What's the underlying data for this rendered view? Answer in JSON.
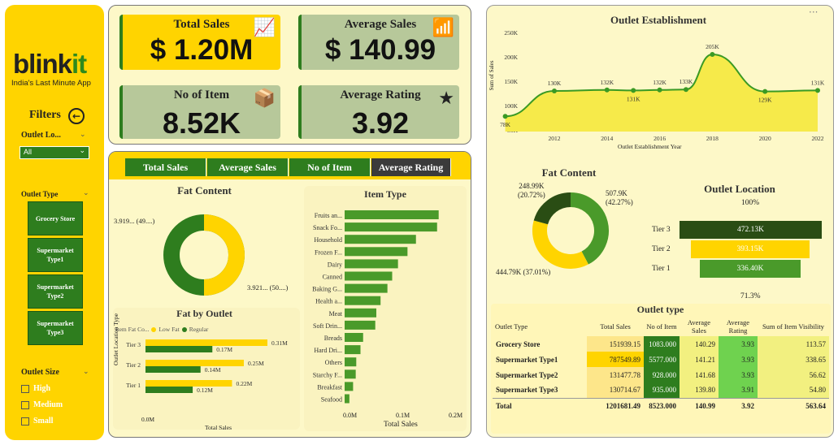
{
  "sidebar": {
    "logo_main": "blink",
    "logo_accent": "it",
    "tagline": "India's Last Minute App",
    "filters_label": "Filters",
    "outlet_location_label": "Outlet Lo...",
    "outlet_location_value": "All",
    "outlet_type_label": "Outlet Type",
    "outlet_types": [
      "Grocery Store",
      "Supermarket Type1",
      "Supermarket Type2",
      "Supermarket Type3"
    ],
    "outlet_size_label": "Outlet Size",
    "outlet_sizes": [
      "High",
      "Medium",
      "Small"
    ]
  },
  "kpis": {
    "total_sales": {
      "title": "Total Sales",
      "value": "$ 1.20M"
    },
    "average_sales": {
      "title": "Average Sales",
      "value": "$ 140.99"
    },
    "no_of_item": {
      "title": "No of Item",
      "value": "8.52K"
    },
    "average_rating": {
      "title": "Average Rating",
      "value": "3.92"
    }
  },
  "tabs": [
    "Total Sales",
    "Average Sales",
    "No of Item",
    "Average Rating"
  ],
  "active_tab": "Average Rating",
  "colors": {
    "yellow": "#ffd400",
    "green": "#2e7d1e",
    "dark_green": "#2a4d14",
    "light_green": "#4a9a2a",
    "kpi_green": "#b7c89a",
    "panel_bg": "#fdf8c8"
  },
  "fat_content_left": {
    "title": "Fat Content",
    "label_left": "3.919... (49....)",
    "label_right": "3.921... (50....)"
  },
  "fat_by_outlet": {
    "title": "Fat by Outlet",
    "legend_title": "Item Fat Co...",
    "legend": [
      "Low Fat",
      "Regular"
    ],
    "ylabel": "Outlet Location Type",
    "xlabel": "Total Sales",
    "x_tick": "0.0M",
    "tiers": [
      "Tier 3",
      "Tier 2",
      "Tier 1"
    ],
    "labels_low": [
      "0.31M",
      "0.25M",
      "0.22M"
    ],
    "labels_reg": [
      "0.17M",
      "0.14M",
      "0.12M"
    ]
  },
  "item_type": {
    "title": "Item Type",
    "xlabel": "Total Sales",
    "x_ticks": [
      "0.0M",
      "0.1M",
      "0.2M"
    ]
  },
  "outlet_establishment": {
    "title": "Outlet Establishment",
    "ylabel": "Sum of Sales",
    "xlabel": "Outlet Establishment Year",
    "y_ticks": [
      "250K",
      "200K",
      "150K",
      "100K",
      "50K"
    ],
    "x_ticks": [
      "2012",
      "2014",
      "2016",
      "2018",
      "2020",
      "2022"
    ],
    "menu": "···"
  },
  "fat_content_right": {
    "title": "Fat Content",
    "label_a": "248.99K",
    "label_a_pct": "(20.72%)",
    "label_b": "507.9K",
    "label_b_pct": "(42.27%)",
    "label_c": "444.79K (37.01%)"
  },
  "outlet_location": {
    "title": "Outlet Location",
    "top_pct": "100%",
    "bottom_pct": "71.3%",
    "tiers": [
      "Tier 3",
      "Tier 2",
      "Tier 1"
    ],
    "values": [
      "472.13K",
      "393.15K",
      "336.40K"
    ]
  },
  "outlet_type_table": {
    "title": "Outlet type",
    "headers": [
      "Outlet Type",
      "Total Sales",
      "No of Item",
      "Average Sales",
      "Average Rating",
      "Sum of Item Visibility"
    ],
    "rows": [
      [
        "Grocery Store",
        "151939.15",
        "1083.000",
        "140.29",
        "3.93",
        "113.57"
      ],
      [
        "Supermarket Type1",
        "787549.89",
        "5577.000",
        "141.21",
        "3.93",
        "338.65"
      ],
      [
        "Supermarket Type2",
        "131477.78",
        "928.000",
        "141.68",
        "3.93",
        "56.62"
      ],
      [
        "Supermarket Type3",
        "130714.67",
        "935.000",
        "139.80",
        "3.91",
        "54.80"
      ]
    ],
    "total": [
      "Total",
      "1201681.49",
      "8523.000",
      "140.99",
      "3.92",
      "563.64"
    ]
  },
  "chart_data": [
    {
      "type": "bar",
      "title": "Item Type",
      "xlabel": "Total Sales",
      "orientation": "horizontal",
      "categories": [
        "Fruits an...",
        "Snack Fo...",
        "Household",
        "Frozen F...",
        "Dairy",
        "Canned",
        "Baking G...",
        "Health a...",
        "Meat",
        "Soft Drin...",
        "Breads",
        "Hard Dri...",
        "Others",
        "Starchy F...",
        "Breakfast",
        "Seafood"
      ],
      "values": [
        0.178,
        0.175,
        0.135,
        0.119,
        0.101,
        0.09,
        0.081,
        0.068,
        0.06,
        0.058,
        0.035,
        0.03,
        0.022,
        0.021,
        0.016,
        0.009
      ],
      "xlim": [
        0,
        0.2
      ]
    },
    {
      "type": "bar",
      "title": "Fat by Outlet",
      "orientation": "horizontal",
      "categories": [
        "Tier 3",
        "Tier 2",
        "Tier 1"
      ],
      "series": [
        {
          "name": "Low Fat",
          "values": [
            0.31,
            0.25,
            0.22
          ]
        },
        {
          "name": "Regular",
          "values": [
            0.17,
            0.14,
            0.12
          ]
        }
      ],
      "xlabel": "Total Sales",
      "ylabel": "Outlet Location Type"
    },
    {
      "type": "area",
      "title": "Outlet Establishment",
      "xlabel": "Outlet Establishment Year",
      "ylabel": "Sum of Sales",
      "x": [
        2011,
        2012,
        2014,
        2015,
        2016,
        2017,
        2018,
        2020,
        2022
      ],
      "values": [
        78,
        130,
        132,
        131,
        132,
        133,
        205,
        129,
        131
      ],
      "point_labels": [
        "78K",
        "130K",
        "132K",
        "131K",
        "132K",
        "133K",
        "205K",
        "129K",
        "131K"
      ],
      "ylim": [
        50,
        250
      ]
    },
    {
      "type": "pie",
      "title": "Fat Content",
      "values": [
        507.9,
        444.79,
        248.99
      ],
      "percent": [
        42.27,
        37.01,
        20.72
      ]
    },
    {
      "type": "bar",
      "title": "Outlet Location",
      "categories": [
        "Tier 3",
        "Tier 2",
        "Tier 1"
      ],
      "values": [
        472.13,
        393.15,
        336.4
      ]
    }
  ]
}
